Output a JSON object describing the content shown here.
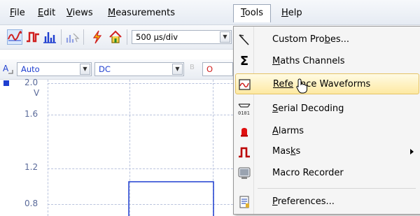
{
  "menubar": {
    "items": [
      {
        "label": "File",
        "key": "F",
        "rest": "ile"
      },
      {
        "label": "Edit",
        "key": "E",
        "rest": "dit"
      },
      {
        "label": "Views",
        "key": "V",
        "rest": "iews"
      },
      {
        "label": "Measurements",
        "key": "M",
        "rest": "easurements"
      },
      {
        "label": "Tools",
        "key": "T",
        "rest": "ools"
      },
      {
        "label": "Help",
        "key": "H",
        "rest": "elp"
      }
    ]
  },
  "toolbar": {
    "timebase_value": "500 µs/div",
    "channel_label": "Auto",
    "coupling_value": "DC",
    "channel_b_partial": "O"
  },
  "plot": {
    "y_labels": [
      "2.0",
      "V",
      "1.6",
      "1.2",
      "0.8"
    ],
    "trace_color": "#1f3fd0"
  },
  "tools_menu": {
    "items": [
      {
        "pre": "Custom Pro",
        "key": "b",
        "post": "es...",
        "icon": "custom-probes-icon"
      },
      {
        "pre": "",
        "key": "M",
        "post": "aths Channels",
        "icon": "sigma-icon"
      },
      {
        "pre": "",
        "key": "R",
        "post": "efe",
        "post2": "nce Waveforms",
        "icon": "reference-waveform-icon"
      },
      {
        "pre": "",
        "key": "S",
        "post": "erial Decoding",
        "icon": "serial-decoding-icon"
      },
      {
        "pre": "",
        "key": "A",
        "post": "larms",
        "icon": "alarm-bell-icon"
      },
      {
        "pre": "Mas",
        "key": "k",
        "post": "s",
        "icon": "masks-icon"
      },
      {
        "pre": "Macro Recorder",
        "key": "",
        "post": "",
        "icon": "macro-recorder-icon"
      },
      {
        "pre": "",
        "key": "P",
        "post": "references...",
        "icon": "preferences-icon"
      }
    ]
  },
  "colors": {
    "accent_red": "#d02020",
    "accent_blue": "#1f3fd0",
    "highlight": "#fde9a2"
  }
}
